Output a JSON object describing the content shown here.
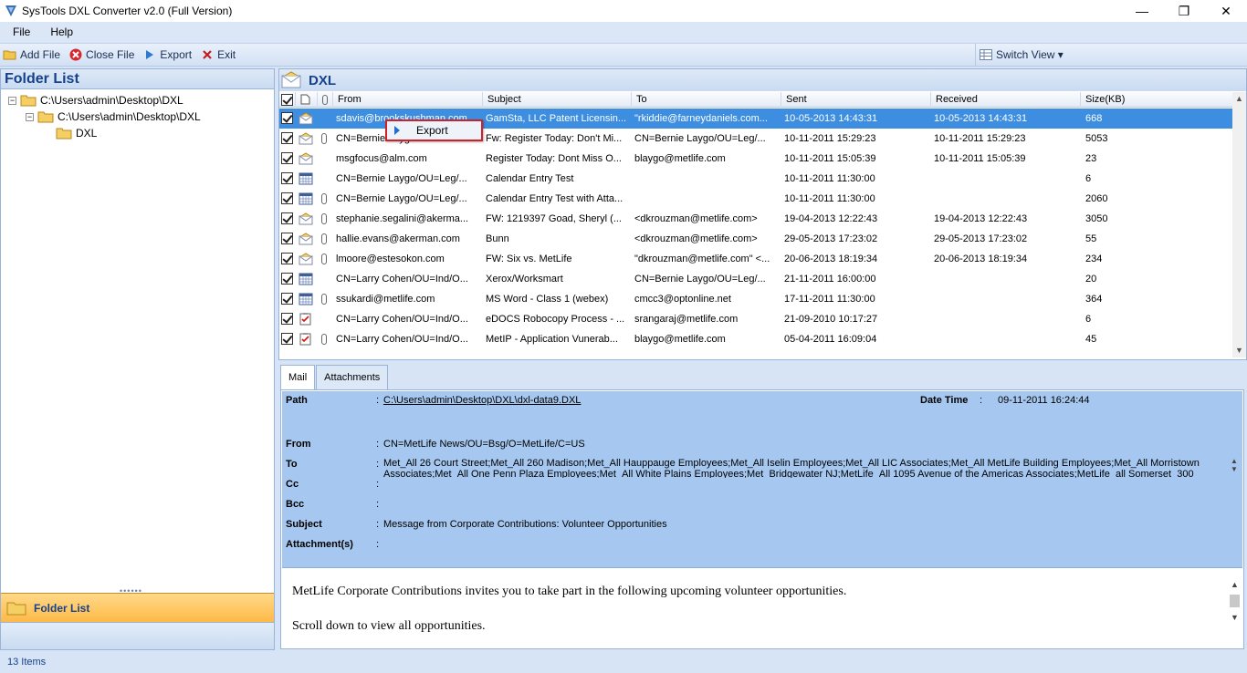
{
  "window": {
    "title": "SysTools DXL Converter v2.0 (Full Version)",
    "minimize": "—",
    "maximize": "❐",
    "close": "✕"
  },
  "menu": [
    "File",
    "Help"
  ],
  "toolbar": {
    "add_file": "Add File",
    "close_file": "Close File",
    "export": "Export",
    "exit": "Exit",
    "switch_view": "Switch View ▾"
  },
  "left": {
    "title": "Folder List",
    "tree": [
      "C:\\Users\\admin\\Desktop\\DXL",
      "C:\\Users\\admin\\Desktop\\DXL",
      "DXL"
    ],
    "nav_label": "Folder List"
  },
  "mail_list": {
    "folder_title": "DXL",
    "columns": [
      "From",
      "Subject",
      "To",
      "Sent",
      "Received",
      "Size(KB)"
    ],
    "rows": [
      {
        "icon": "mail",
        "attach": false,
        "from": "sdavis@brookskushman.com",
        "subject": "GamSta, LLC Patent Licensin...",
        "to": "\"rkiddie@farneydaniels.com...",
        "sent": "10-05-2013 14:43:31",
        "received": "10-05-2013 14:43:31",
        "size": "668"
      },
      {
        "icon": "mail",
        "attach": true,
        "from": "CN=Bernie Laygo",
        "subject": "Fw: Register Today: Don't Mi...",
        "to": "CN=Bernie Laygo/OU=Leg/...",
        "sent": "10-11-2011 15:29:23",
        "received": "10-11-2011 15:29:23",
        "size": "5053"
      },
      {
        "icon": "mail",
        "attach": false,
        "from": "msgfocus@alm.com",
        "subject": "Register Today: Dont Miss O...",
        "to": "blaygo@metlife.com",
        "sent": "10-11-2011 15:05:39",
        "received": "10-11-2011 15:05:39",
        "size": "23"
      },
      {
        "icon": "calendar",
        "attach": false,
        "from": "CN=Bernie Laygo/OU=Leg/...",
        "subject": "Calendar Entry Test",
        "to": "",
        "sent": "10-11-2011 11:30:00",
        "received": "",
        "size": "6"
      },
      {
        "icon": "calendar",
        "attach": true,
        "from": "CN=Bernie Laygo/OU=Leg/...",
        "subject": "Calendar Entry Test with Atta...",
        "to": "",
        "sent": "10-11-2011 11:30:00",
        "received": "",
        "size": "2060"
      },
      {
        "icon": "mail",
        "attach": true,
        "from": "stephanie.segalini@akerma...",
        "subject": "FW: 1219397 Goad, Sheryl (...",
        "to": "<dkrouzman@metlife.com>",
        "sent": "19-04-2013 12:22:43",
        "received": "19-04-2013 12:22:43",
        "size": "3050"
      },
      {
        "icon": "mail",
        "attach": true,
        "from": "hallie.evans@akerman.com",
        "subject": "Bunn",
        "to": "<dkrouzman@metlife.com>",
        "sent": "29-05-2013 17:23:02",
        "received": "29-05-2013 17:23:02",
        "size": "55"
      },
      {
        "icon": "mail",
        "attach": true,
        "from": "lmoore@estesokon.com",
        "subject": "FW: Six vs. MetLife",
        "to": "\"dkrouzman@metlife.com\" <...",
        "sent": "20-06-2013 18:19:34",
        "received": "20-06-2013 18:19:34",
        "size": "234"
      },
      {
        "icon": "calendar",
        "attach": false,
        "from": "CN=Larry Cohen/OU=Ind/O...",
        "subject": "Xerox/Worksmart",
        "to": "CN=Bernie Laygo/OU=Leg/...",
        "sent": "21-11-2011 16:00:00",
        "received": "",
        "size": "20"
      },
      {
        "icon": "calendar",
        "attach": true,
        "from": "ssukardi@metlife.com",
        "subject": "MS Word - Class 1 (webex)",
        "to": "cmcc3@optonline.net",
        "sent": "17-11-2011 11:30:00",
        "received": "",
        "size": "364"
      },
      {
        "icon": "task",
        "attach": false,
        "from": "CN=Larry Cohen/OU=Ind/O...",
        "subject": "eDOCS Robocopy Process - ...",
        "to": "srangaraj@metlife.com",
        "sent": "21-09-2010 10:17:27",
        "received": "",
        "size": "6"
      },
      {
        "icon": "task",
        "attach": true,
        "from": "CN=Larry Cohen/OU=Ind/O...",
        "subject": "MetIP - Application Vunerab...",
        "to": "blaygo@metlife.com",
        "sent": "05-04-2011 16:09:04",
        "received": "",
        "size": "45"
      }
    ]
  },
  "context_menu": {
    "label": "Export"
  },
  "tabs": [
    "Mail",
    "Attachments"
  ],
  "detail": {
    "path_label": "Path",
    "path_value": "C:\\Users\\admin\\Desktop\\DXL\\dxl-data9.DXL",
    "datetime_label": "Date Time",
    "datetime_value": "09-11-2011 16:24:44",
    "from_label": "From",
    "from_value": "CN=MetLife News/OU=Bsg/O=MetLife/C=US",
    "to_label": "To",
    "to_value": "Met_All 26 Court Street;Met_All 260 Madison;Met_All Hauppauge Employees;Met_All Iselin Employees;Met_All LIC Associates;Met_All MetLife Building Employees;Met_All Morristown",
    "to_value2": "Associates;Met_All One Penn Plaza Employees;Met_All White Plains Employees;Met_Bridgewater NJ;MetLife_All 1095 Avenue of the Americas Associates;MetLife_all Somerset_300",
    "cc_label": "Cc",
    "bcc_label": "Bcc",
    "subject_label": "Subject",
    "subject_value": "Message from Corporate Contributions: Volunteer Opportunities",
    "attachments_label": "Attachment(s)",
    "body_line1": "MetLife Corporate Contributions invites you to take part in the following upcoming volunteer opportunities.",
    "body_line2": "Scroll down to view all opportunities."
  },
  "status": {
    "items": "13 Items"
  }
}
